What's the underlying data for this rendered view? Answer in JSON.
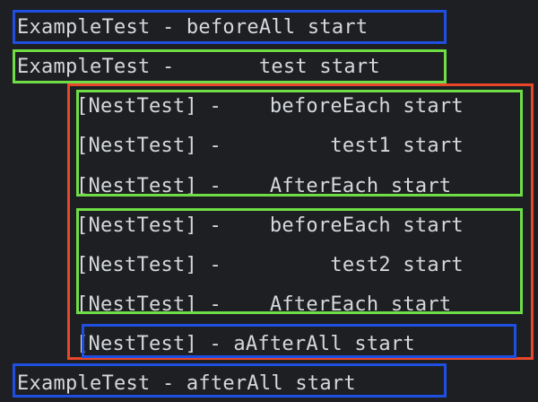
{
  "colors": {
    "background": "#1e1f22",
    "text": "#d5d8dc",
    "blue_box": "#1f4fe0",
    "green_box": "#6fdd45",
    "red_box": "#e8472b"
  },
  "console": {
    "lines": [
      "ExampleTest - beforeAll start",
      "ExampleTest -       test start",
      "[NestTest] -    beforeEach start",
      "[NestTest] -         test1 start",
      "[NestTest] -    AfterEach start",
      "[NestTest] -    beforeEach start",
      "[NestTest] -         test2 start",
      "[NestTest] -    AfterEach start",
      "[NestTest] - aAfterAll start",
      "ExampleTest - afterAll start"
    ]
  }
}
